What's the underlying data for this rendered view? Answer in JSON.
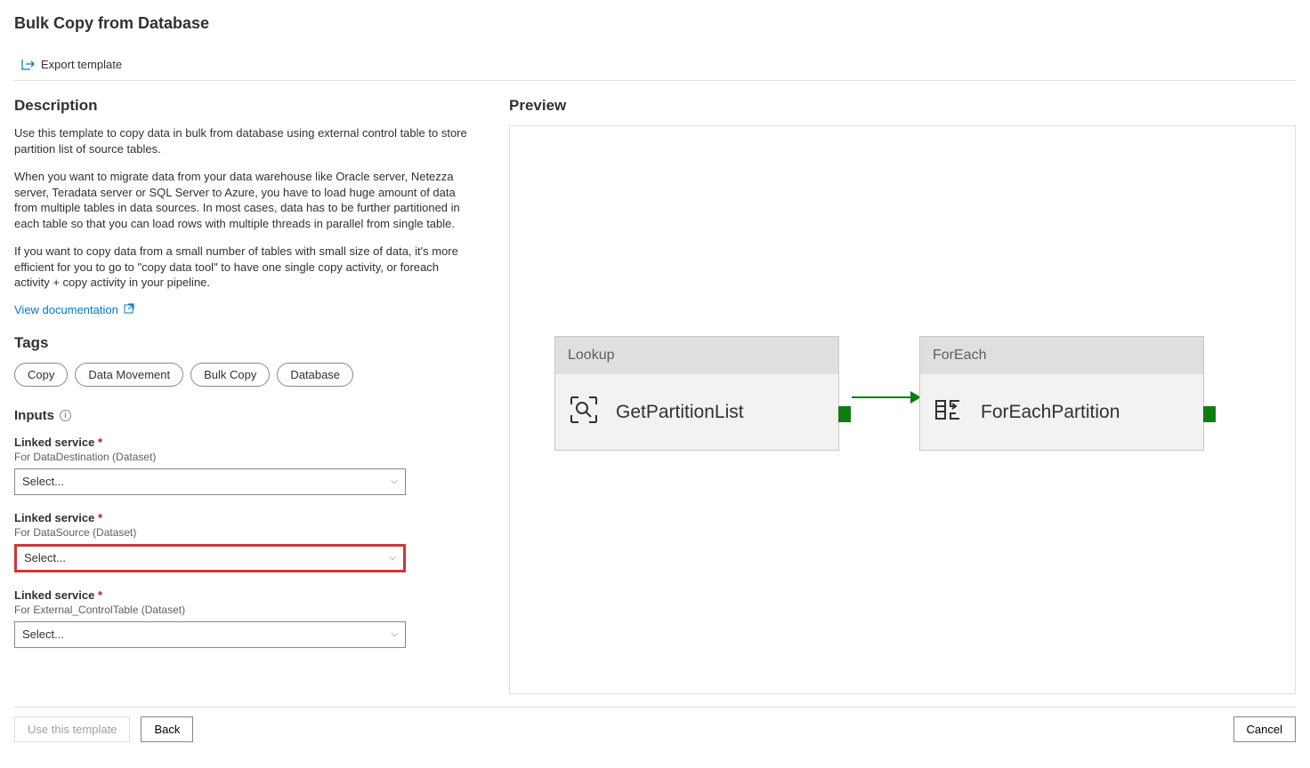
{
  "page_title": "Bulk Copy from Database",
  "export_template_label": "Export template",
  "left": {
    "description_title": "Description",
    "paragraph1": "Use this template to copy data in bulk from database using external control table to store partition list of source tables.",
    "paragraph2": "When you want to migrate data from your data warehouse like Oracle server, Netezza server, Teradata server or SQL Server to Azure, you have to load huge amount of data from multiple tables in data sources. In most cases, data has to be further partitioned in each table so that you can load rows with multiple threads in parallel from single table.",
    "paragraph3": "If you want to copy data from a small number of tables with small size of data, it's more efficient for you to go to \"copy data tool\" to have one single copy activity, or foreach activity + copy activity in your pipeline.",
    "view_documentation_label": "View documentation",
    "tags_title": "Tags",
    "tags": [
      "Copy",
      "Data Movement",
      "Bulk Copy",
      "Database"
    ],
    "inputs_title": "Inputs",
    "inputs": [
      {
        "label": "Linked service",
        "sublabel": "For DataDestination (Dataset)",
        "placeholder": "Select...",
        "highlighted": false
      },
      {
        "label": "Linked service",
        "sublabel": "For DataSource (Dataset)",
        "placeholder": "Select...",
        "highlighted": true
      },
      {
        "label": "Linked service",
        "sublabel": "For External_ControlTable (Dataset)",
        "placeholder": "Select...",
        "highlighted": false
      }
    ]
  },
  "preview": {
    "title": "Preview",
    "lookup_header": "Lookup",
    "lookup_name": "GetPartitionList",
    "foreach_header": "ForEach",
    "foreach_name": "ForEachPartition"
  },
  "footer": {
    "use_template": "Use this template",
    "back": "Back",
    "cancel": "Cancel"
  }
}
